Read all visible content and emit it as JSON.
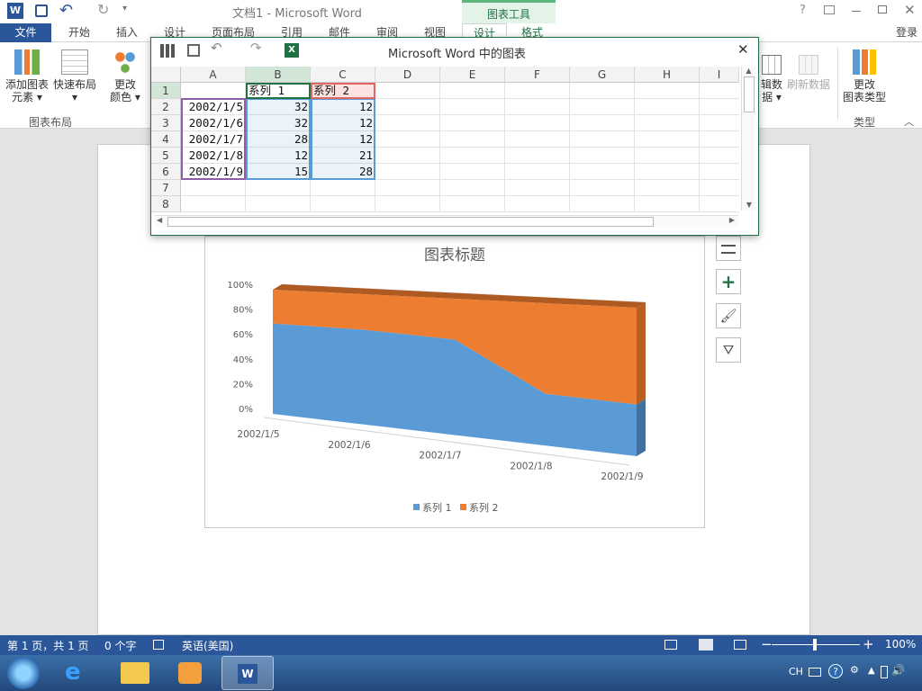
{
  "app": {
    "doc_title": "文档1 - Microsoft Word",
    "tools_group": "图表工具",
    "help": "?",
    "login": "登录"
  },
  "tabs": [
    {
      "label": "文件"
    },
    {
      "label": "开始"
    },
    {
      "label": "插入"
    },
    {
      "label": "设计"
    },
    {
      "label": "页面布局"
    },
    {
      "label": "引用"
    },
    {
      "label": "邮件"
    },
    {
      "label": "审阅"
    },
    {
      "label": "视图"
    },
    {
      "label": "设计"
    },
    {
      "label": "格式"
    }
  ],
  "ribbon": {
    "add_element": "添加图表\n元素 ▾",
    "quick_layout": "快速布局\n▾",
    "change_colors": "更改\n颜色 ▾",
    "group_layout": "图表布局",
    "edit_data": "辑数\n据 ▾",
    "refresh_data": "刷新数据",
    "change_type": "更改\n图表类型",
    "group_type": "类型"
  },
  "sheet": {
    "title": "Microsoft Word 中的图表",
    "columns": [
      "A",
      "B",
      "C",
      "D",
      "E",
      "F",
      "G",
      "H",
      "I"
    ],
    "rows": [
      "1",
      "2",
      "3",
      "4",
      "5",
      "6",
      "7",
      "8"
    ],
    "cells": [
      [
        "",
        "系列 1",
        "系列 2"
      ],
      [
        "2002/1/5",
        "32",
        "12"
      ],
      [
        "2002/1/6",
        "32",
        "12"
      ],
      [
        "2002/1/7",
        "28",
        "12"
      ],
      [
        "2002/1/8",
        "12",
        "21"
      ],
      [
        "2002/1/9",
        "15",
        "28"
      ]
    ]
  },
  "chart_data": {
    "type": "area",
    "subtype": "3d-100%-stacked",
    "title": "图表标题",
    "categories": [
      "2002/1/5",
      "2002/1/6",
      "2002/1/7",
      "2002/1/8",
      "2002/1/9"
    ],
    "series": [
      {
        "name": "系列 1",
        "values": [
          32,
          32,
          28,
          12,
          15
        ],
        "color": "#5b9bd5"
      },
      {
        "name": "系列 2",
        "values": [
          12,
          12,
          12,
          21,
          28
        ],
        "color": "#ed7d31"
      }
    ],
    "y_ticks": [
      "0%",
      "20%",
      "40%",
      "60%",
      "80%",
      "100%"
    ],
    "ylim": [
      0,
      100
    ],
    "legend_position": "bottom",
    "legend": [
      {
        "label": "系列 1"
      },
      {
        "label": "系列 2"
      }
    ]
  },
  "status": {
    "page": "第 1 页，共 1 页",
    "words": "0 个字",
    "lang": "英语(美国)",
    "zoom": "100%"
  },
  "tray": {
    "ime": "CH"
  }
}
